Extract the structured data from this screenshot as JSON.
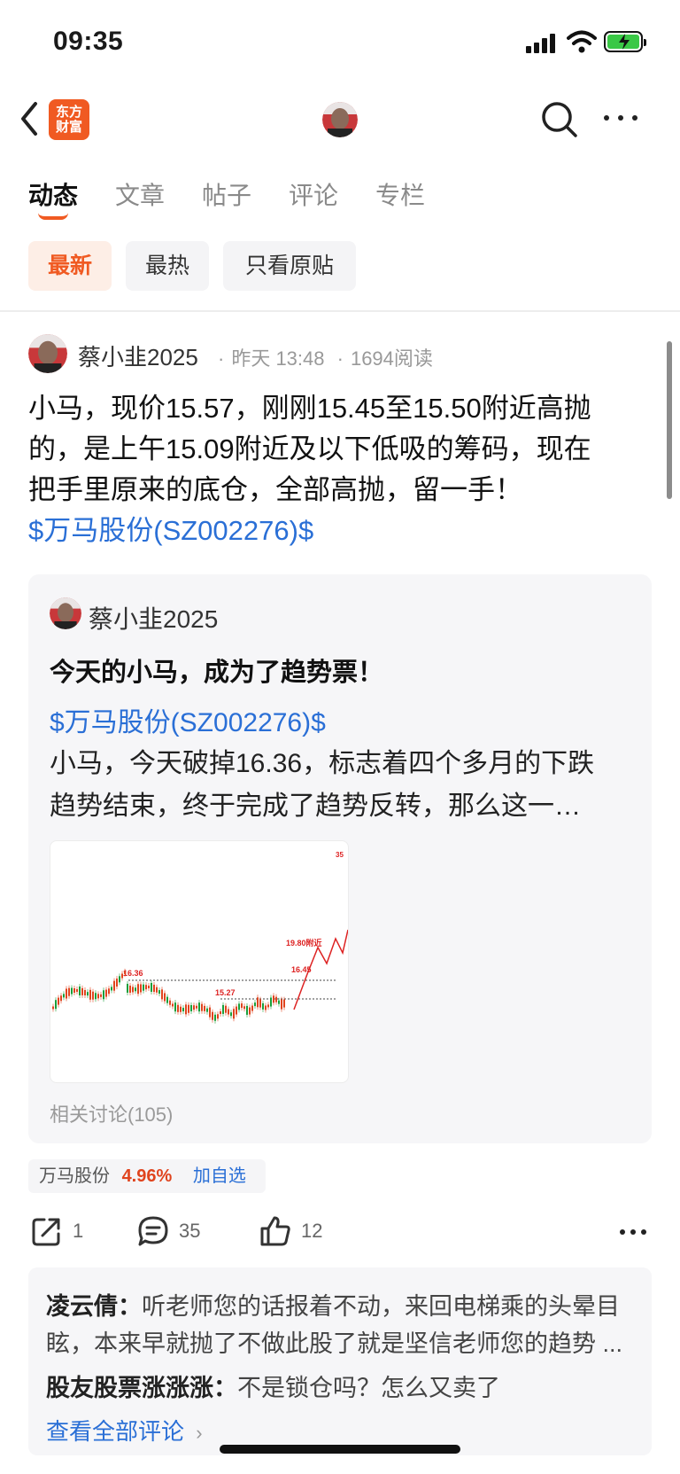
{
  "status_bar": {
    "time": "09:35"
  },
  "header": {
    "logo_line1": "东方",
    "logo_line2": "财富"
  },
  "tabs": [
    {
      "label": "动态",
      "active": true
    },
    {
      "label": "文章"
    },
    {
      "label": "帖子"
    },
    {
      "label": "评论"
    },
    {
      "label": "专栏"
    }
  ],
  "filters": [
    {
      "label": "最新",
      "active": true
    },
    {
      "label": "最热"
    },
    {
      "label": "只看原贴"
    }
  ],
  "post": {
    "author": "蔡小韭2025",
    "time": "昨天 13:48",
    "reads": "1694阅读",
    "text_line1": "小马，现价15.57，刚刚15.45至15.50附近高抛",
    "text_line2": "的，是上午15.09附近及以下低吸的筹码，现在",
    "text_line3": "把手里原来的底仓，全部高抛，留一手！",
    "stock_link": "$万马股份(SZ002276)$"
  },
  "quoted_post": {
    "author": "蔡小韭2025",
    "title": "今天的小马，成为了趋势票！",
    "stock_link": "$万马股份(SZ002276)$",
    "body_line1": "小马，今天破掉16.36，标志着四个多月的下跌",
    "body_line2": "趋势结束，终于完成了趋势反转，那么这一…",
    "related": "相关讨论(105)",
    "chart_labels": {
      "a": "16.36",
      "b": "15.27",
      "c": "16.45",
      "d": "19.80附近",
      "e": "35"
    }
  },
  "stock_tag": {
    "name": "万马股份",
    "change": "4.96%",
    "add": "加自选"
  },
  "actions": {
    "share": "1",
    "comment": "35",
    "like": "12"
  },
  "comments": [
    {
      "name": "凌云倩：",
      "text": "听老师您的话报着不动，来回电梯乘的头晕目"
    },
    {
      "name": "",
      "text": "眩，本来早就抛了不做此股了就是坚信老师您的趋势 ..."
    },
    {
      "name": "股友股票涨涨涨：",
      "text": "不是锁仓吗？怎么又卖了"
    }
  ],
  "see_all": "查看全部评论",
  "colors": {
    "accent": "#f05a22",
    "link": "#2a6fd6",
    "up": "#e0441e",
    "candle_down": "#1a9e3a"
  }
}
